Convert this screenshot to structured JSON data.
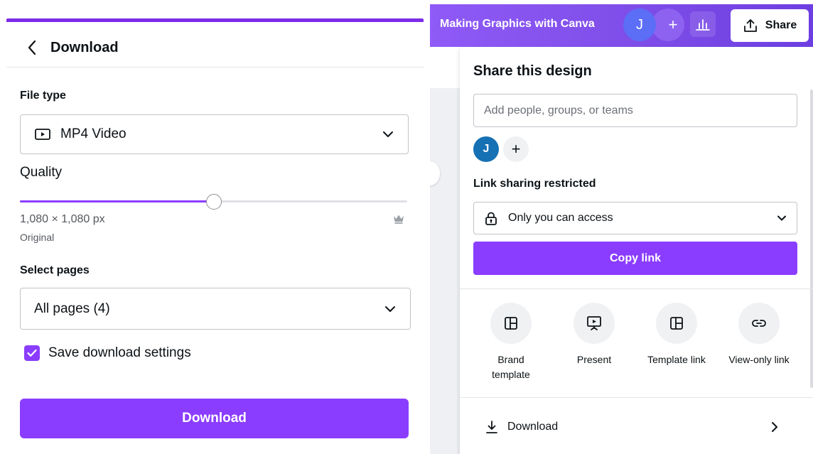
{
  "download_panel": {
    "title": "Download",
    "file_type_label": "File type",
    "file_type_value": "MP4 Video",
    "quality_label": "Quality",
    "quality_fraction": 0.5,
    "size_text": "1,080 × 1,080 px",
    "size_caption": "Original",
    "select_pages_label": "Select pages",
    "pages_value": "All pages (4)",
    "save_settings_label": "Save download settings",
    "save_settings_checked": true,
    "download_button": "Download"
  },
  "editor_topbar": {
    "doc_title": "Making Graphics with Canva",
    "avatar_initial": "J",
    "add_label": "+",
    "share_button": "Share"
  },
  "share_popover": {
    "title": "Share this design",
    "people_placeholder": "Add people, groups, or teams",
    "member_initial": "J",
    "add_member_label": "+",
    "link_sharing_label": "Link sharing restricted",
    "access_value": "Only you can access",
    "copy_link_button": "Copy link",
    "options": [
      {
        "label": "Brand template",
        "icon": "layout-icon"
      },
      {
        "label": "Present",
        "icon": "present-icon"
      },
      {
        "label": "Template link",
        "icon": "layout-icon"
      },
      {
        "label": "View-only link",
        "icon": "link-icon"
      }
    ],
    "download_row": "Download"
  },
  "colors": {
    "brand_purple": "#8b3dff",
    "topbar_gradient_start": "#8f5af7",
    "member_avatar": "#1670b4"
  }
}
